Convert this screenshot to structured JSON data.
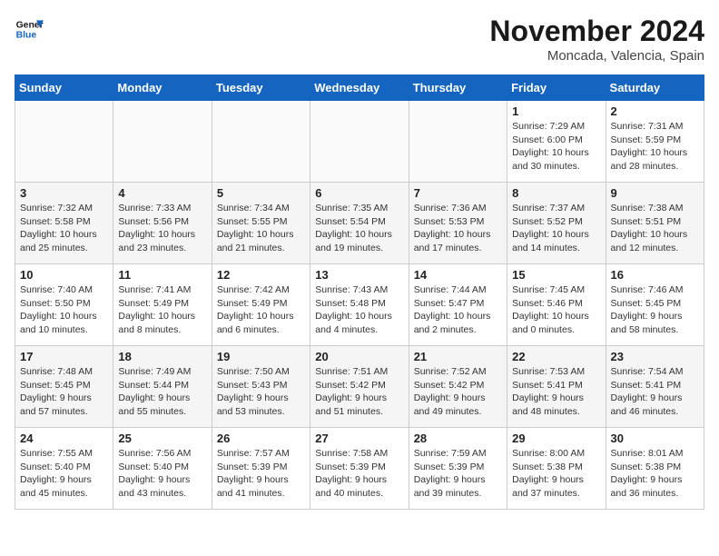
{
  "logo": {
    "general": "General",
    "blue": "Blue"
  },
  "title": "November 2024",
  "location": "Moncada, Valencia, Spain",
  "days_header": [
    "Sunday",
    "Monday",
    "Tuesday",
    "Wednesday",
    "Thursday",
    "Friday",
    "Saturday"
  ],
  "weeks": [
    [
      {
        "day": "",
        "info": ""
      },
      {
        "day": "",
        "info": ""
      },
      {
        "day": "",
        "info": ""
      },
      {
        "day": "",
        "info": ""
      },
      {
        "day": "",
        "info": ""
      },
      {
        "day": "1",
        "info": "Sunrise: 7:29 AM\nSunset: 6:00 PM\nDaylight: 10 hours and 30 minutes."
      },
      {
        "day": "2",
        "info": "Sunrise: 7:31 AM\nSunset: 5:59 PM\nDaylight: 10 hours and 28 minutes."
      }
    ],
    [
      {
        "day": "3",
        "info": "Sunrise: 7:32 AM\nSunset: 5:58 PM\nDaylight: 10 hours and 25 minutes."
      },
      {
        "day": "4",
        "info": "Sunrise: 7:33 AM\nSunset: 5:56 PM\nDaylight: 10 hours and 23 minutes."
      },
      {
        "day": "5",
        "info": "Sunrise: 7:34 AM\nSunset: 5:55 PM\nDaylight: 10 hours and 21 minutes."
      },
      {
        "day": "6",
        "info": "Sunrise: 7:35 AM\nSunset: 5:54 PM\nDaylight: 10 hours and 19 minutes."
      },
      {
        "day": "7",
        "info": "Sunrise: 7:36 AM\nSunset: 5:53 PM\nDaylight: 10 hours and 17 minutes."
      },
      {
        "day": "8",
        "info": "Sunrise: 7:37 AM\nSunset: 5:52 PM\nDaylight: 10 hours and 14 minutes."
      },
      {
        "day": "9",
        "info": "Sunrise: 7:38 AM\nSunset: 5:51 PM\nDaylight: 10 hours and 12 minutes."
      }
    ],
    [
      {
        "day": "10",
        "info": "Sunrise: 7:40 AM\nSunset: 5:50 PM\nDaylight: 10 hours and 10 minutes."
      },
      {
        "day": "11",
        "info": "Sunrise: 7:41 AM\nSunset: 5:49 PM\nDaylight: 10 hours and 8 minutes."
      },
      {
        "day": "12",
        "info": "Sunrise: 7:42 AM\nSunset: 5:49 PM\nDaylight: 10 hours and 6 minutes."
      },
      {
        "day": "13",
        "info": "Sunrise: 7:43 AM\nSunset: 5:48 PM\nDaylight: 10 hours and 4 minutes."
      },
      {
        "day": "14",
        "info": "Sunrise: 7:44 AM\nSunset: 5:47 PM\nDaylight: 10 hours and 2 minutes."
      },
      {
        "day": "15",
        "info": "Sunrise: 7:45 AM\nSunset: 5:46 PM\nDaylight: 10 hours and 0 minutes."
      },
      {
        "day": "16",
        "info": "Sunrise: 7:46 AM\nSunset: 5:45 PM\nDaylight: 9 hours and 58 minutes."
      }
    ],
    [
      {
        "day": "17",
        "info": "Sunrise: 7:48 AM\nSunset: 5:45 PM\nDaylight: 9 hours and 57 minutes."
      },
      {
        "day": "18",
        "info": "Sunrise: 7:49 AM\nSunset: 5:44 PM\nDaylight: 9 hours and 55 minutes."
      },
      {
        "day": "19",
        "info": "Sunrise: 7:50 AM\nSunset: 5:43 PM\nDaylight: 9 hours and 53 minutes."
      },
      {
        "day": "20",
        "info": "Sunrise: 7:51 AM\nSunset: 5:42 PM\nDaylight: 9 hours and 51 minutes."
      },
      {
        "day": "21",
        "info": "Sunrise: 7:52 AM\nSunset: 5:42 PM\nDaylight: 9 hours and 49 minutes."
      },
      {
        "day": "22",
        "info": "Sunrise: 7:53 AM\nSunset: 5:41 PM\nDaylight: 9 hours and 48 minutes."
      },
      {
        "day": "23",
        "info": "Sunrise: 7:54 AM\nSunset: 5:41 PM\nDaylight: 9 hours and 46 minutes."
      }
    ],
    [
      {
        "day": "24",
        "info": "Sunrise: 7:55 AM\nSunset: 5:40 PM\nDaylight: 9 hours and 45 minutes."
      },
      {
        "day": "25",
        "info": "Sunrise: 7:56 AM\nSunset: 5:40 PM\nDaylight: 9 hours and 43 minutes."
      },
      {
        "day": "26",
        "info": "Sunrise: 7:57 AM\nSunset: 5:39 PM\nDaylight: 9 hours and 41 minutes."
      },
      {
        "day": "27",
        "info": "Sunrise: 7:58 AM\nSunset: 5:39 PM\nDaylight: 9 hours and 40 minutes."
      },
      {
        "day": "28",
        "info": "Sunrise: 7:59 AM\nSunset: 5:39 PM\nDaylight: 9 hours and 39 minutes."
      },
      {
        "day": "29",
        "info": "Sunrise: 8:00 AM\nSunset: 5:38 PM\nDaylight: 9 hours and 37 minutes."
      },
      {
        "day": "30",
        "info": "Sunrise: 8:01 AM\nSunset: 5:38 PM\nDaylight: 9 hours and 36 minutes."
      }
    ]
  ]
}
